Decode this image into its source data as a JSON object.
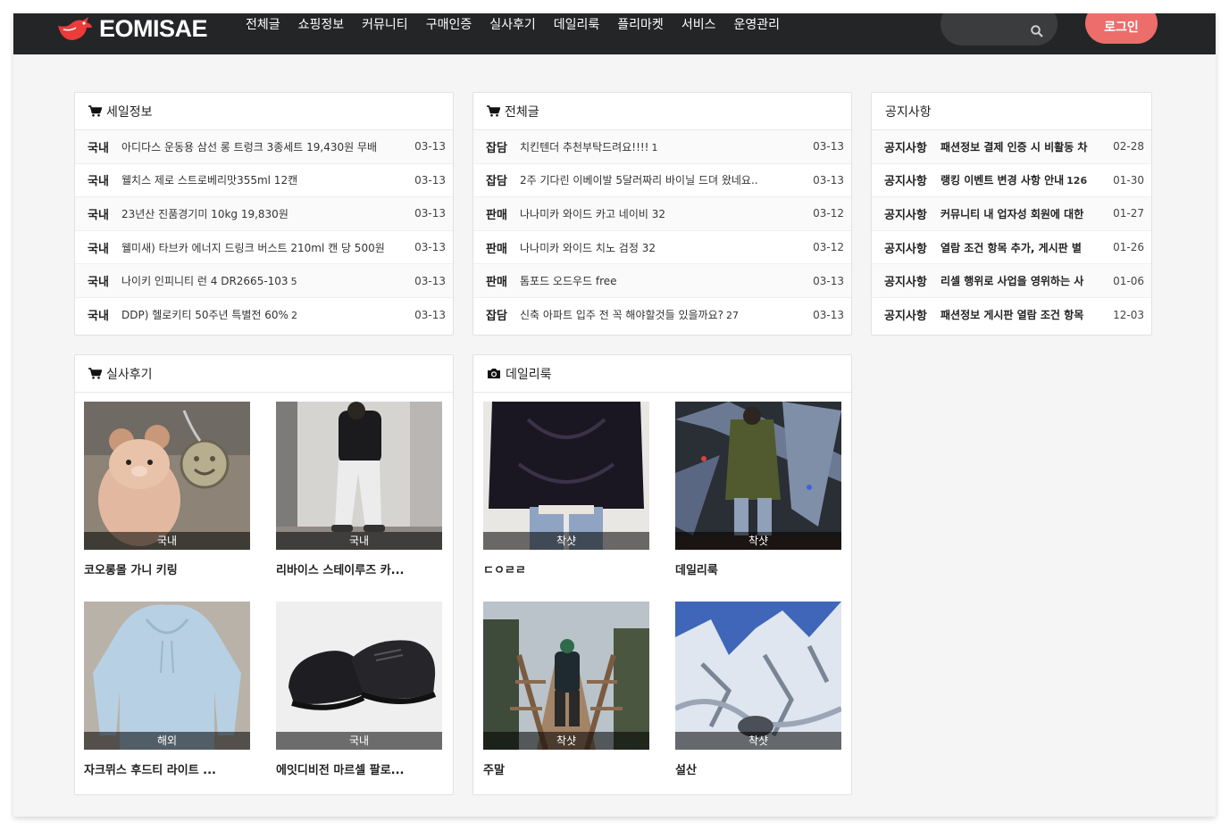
{
  "header": {
    "logo_text": "EOMISAE",
    "nav": [
      "전체글",
      "쇼핑정보",
      "커뮤니티",
      "구매인증",
      "실사후기",
      "데일리룩",
      "플리마켓",
      "서비스",
      "운영관리"
    ],
    "login_label": "로그인",
    "accent_color": "#ec6d6a"
  },
  "sale": {
    "title": "세일정보",
    "rows": [
      {
        "cat": "국내",
        "title": "아디다스 운동용 삼선 롱 트렁크 3종세트 19,430원 무배",
        "count": "",
        "date": "03-13"
      },
      {
        "cat": "국내",
        "title": "웰치스 제로 스트로베리맛355ml 12캔",
        "count": "",
        "date": "03-13"
      },
      {
        "cat": "국내",
        "title": "23년산 진품경기미 10kg 19,830원",
        "count": "",
        "date": "03-13"
      },
      {
        "cat": "국내",
        "title": "웰미새) 타브카 에너지 드링크 버스트 210ml 캔 당 500원",
        "count": "",
        "date": "03-13"
      },
      {
        "cat": "국내",
        "title": "나이키 인피니티 런 4 DR2665-103",
        "count": "5",
        "date": "03-13"
      },
      {
        "cat": "국내",
        "title": "DDP) 헬로키티 50주년 특별전 60%",
        "count": "2",
        "date": "03-13"
      }
    ]
  },
  "all": {
    "title": "전체글",
    "rows": [
      {
        "cat": "잡담",
        "title": "치킨텐더 추천부탁드려요!!!!",
        "count": "1",
        "date": "03-13"
      },
      {
        "cat": "잡담",
        "title": "2주 기다린 이베이발 5달러짜리 바이닐 드뎌 왔네요..",
        "count": "",
        "date": "03-13"
      },
      {
        "cat": "판매",
        "title": "나나미카 와이드 카고 네이비 32",
        "count": "",
        "date": "03-12"
      },
      {
        "cat": "판매",
        "title": "나나미카 와이드 치노 검정 32",
        "count": "",
        "date": "03-12"
      },
      {
        "cat": "판매",
        "title": "톰포드 오드우드 free",
        "count": "",
        "date": "03-13"
      },
      {
        "cat": "잡담",
        "title": "신축 아파트 입주 전 꼭 해야할것들 있을까요?",
        "count": "27",
        "date": "03-13"
      }
    ]
  },
  "notice": {
    "title": "공지사항",
    "rows": [
      {
        "cat": "공지사항",
        "title": "패션정보 결제 인증 시 비활동 차",
        "count": "",
        "date": "02-28"
      },
      {
        "cat": "공지사항",
        "title": "랭킹 이벤트 변경 사항 안내",
        "count": "126",
        "date": "01-30"
      },
      {
        "cat": "공지사항",
        "title": "커뮤니티 내 업자성 회원에 대한",
        "count": "",
        "date": "01-27"
      },
      {
        "cat": "공지사항",
        "title": "열람 조건 항목 추가, 게시판 별",
        "count": "",
        "date": "01-26"
      },
      {
        "cat": "공지사항",
        "title": "리셀 행위로 사업을 영위하는 사",
        "count": "",
        "date": "01-06"
      },
      {
        "cat": "공지사항",
        "title": "패션정보 게시판 열람 조건 항목",
        "count": "",
        "date": "12-03"
      }
    ]
  },
  "review": {
    "title": "실사후기",
    "cards": [
      {
        "tag": "국내",
        "title": "코오롱몰 가니 키링"
      },
      {
        "tag": "국내",
        "title": "리바이스 스테이루즈 카..."
      },
      {
        "tag": "해외",
        "title": "자크뮈스 후드티 라이트 ..."
      },
      {
        "tag": "국내",
        "title": "에잇디비전 마르셀 팔로..."
      }
    ]
  },
  "daily": {
    "title": "데일리룩",
    "cards": [
      {
        "tag": "착샷",
        "title": "ㄷㅇㄹㄹ"
      },
      {
        "tag": "착샷",
        "title": "데일리룩"
      },
      {
        "tag": "착샷",
        "title": "주말"
      },
      {
        "tag": "착샷",
        "title": "설산"
      }
    ]
  }
}
